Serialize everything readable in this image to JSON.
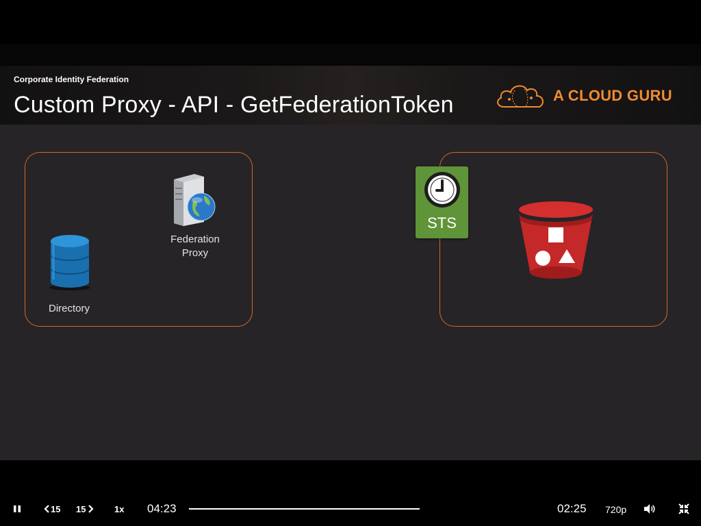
{
  "slide": {
    "section_title": "Corporate Identity Federation",
    "title": "Custom Proxy - API - GetFederationToken",
    "brand": "A CLOUD GURU",
    "nodes": {
      "directory": "Directory",
      "federation_proxy_line1": "Federation",
      "federation_proxy_line2": "Proxy",
      "sts": "STS"
    }
  },
  "player": {
    "skip_back_label": "15",
    "skip_forward_label": "15",
    "speed": "1x",
    "current_time": "04:23",
    "remaining_time": "02:25",
    "quality": "720p"
  },
  "colors": {
    "accent_orange": "#d3682a",
    "brand_orange": "#f28b2f",
    "sts_green": "#5f9438",
    "bucket_red": "#d42f2f",
    "directory_blue": "#1e7bbd"
  },
  "icons": [
    "cloud-guru-logo-icon",
    "database-icon",
    "server-globe-icon",
    "clock-icon",
    "s3-bucket-icon",
    "pause-icon",
    "rewind-icon",
    "forward-icon",
    "volume-icon",
    "exit-fullscreen-icon"
  ]
}
